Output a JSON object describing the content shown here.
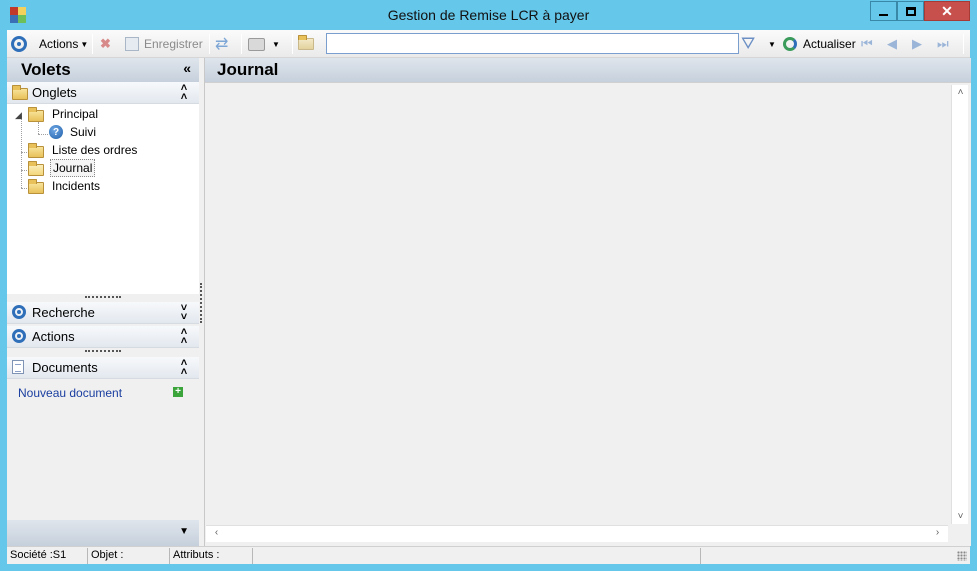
{
  "window": {
    "title": "Gestion de Remise LCR à payer"
  },
  "toolbar": {
    "actions_label": "Actions",
    "save_label": "Enregistrer",
    "search_value": "",
    "refresh_label": "Actualiser"
  },
  "leftpane": {
    "title": "Volets",
    "onglets": {
      "label": "Onglets",
      "tree": [
        {
          "label": "Principal"
        },
        {
          "label": "Suivi"
        },
        {
          "label": "Liste des ordres"
        },
        {
          "label": "Journal"
        },
        {
          "label": "Incidents"
        }
      ],
      "selected": "Journal"
    },
    "recherche": {
      "label": "Recherche"
    },
    "actions": {
      "label": "Actions"
    },
    "documents": {
      "label": "Documents",
      "new_document": "Nouveau document"
    }
  },
  "main": {
    "title": "Journal"
  },
  "statusbar": {
    "societe": "Société :S1",
    "objet": "Objet :",
    "attributs": "Attributs :"
  },
  "colors": {
    "frame": "#65c7ea",
    "accent": "#2f6fb9",
    "close": "#c7504c"
  }
}
